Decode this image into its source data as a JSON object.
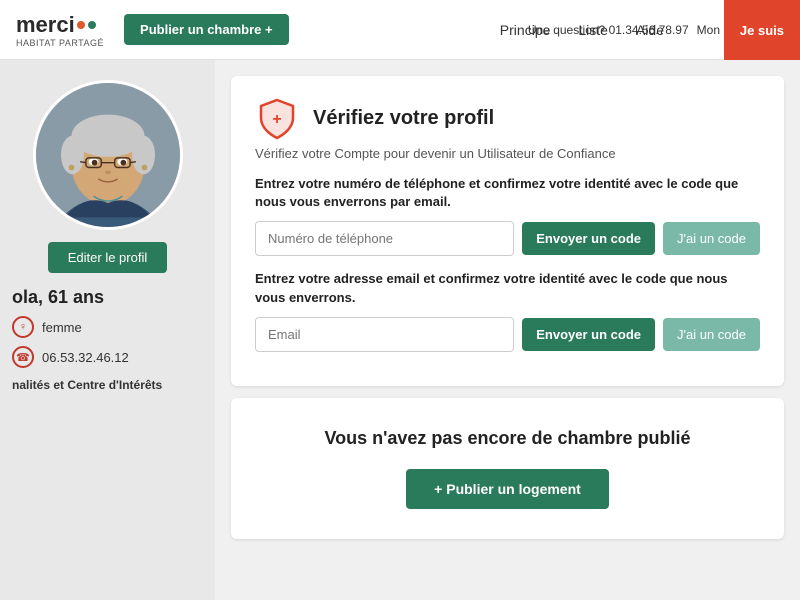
{
  "header": {
    "logo_text": "merci",
    "logo_subtitle": "HABITAT PARTAGÉ",
    "btn_publish_room": "Publier un chambre +",
    "nav": {
      "principe": "Principe",
      "liste": "Liste",
      "aide": "Aide"
    },
    "btn_je_suis": "Je suis",
    "question_text": "Une question? 01.34.56.78.97",
    "mon_text": "Mon"
  },
  "sidebar": {
    "btn_edit_profile": "Editer le profil",
    "user_name": "ola, 61 ans",
    "user_gender": "femme",
    "user_phone": "06.53.32.46.12",
    "interests_label": "nalités et Centre d'Intérêts"
  },
  "verify_card": {
    "title": "Vérifiez votre profil",
    "subtitle": "Vérifiez votre Compte pour devenir un Utilisateur de Confiance",
    "phone_instruction": "Entrez votre numéro de téléphone et confirmez votre identité avec le code que nous vous enverrons par email.",
    "phone_placeholder": "Numéro de téléphone",
    "btn_send_code_1": "Envoyer un code",
    "btn_have_code_1": "J'ai un code",
    "email_instruction": "Entrez votre adresse email et confirmez votre identité avec le code que nous vous enverrons.",
    "email_placeholder": "Email",
    "btn_send_code_2": "Envoyer un code",
    "btn_have_code_2": "J'ai un code"
  },
  "no_room_card": {
    "title": "Vous n'avez pas encore de chambre publié",
    "btn_publish": "+ Publier un logement"
  },
  "colors": {
    "primary_green": "#2a7a5c",
    "light_teal": "#7ab8a8",
    "red": "#c0392b",
    "orange_red": "#e0442a"
  }
}
